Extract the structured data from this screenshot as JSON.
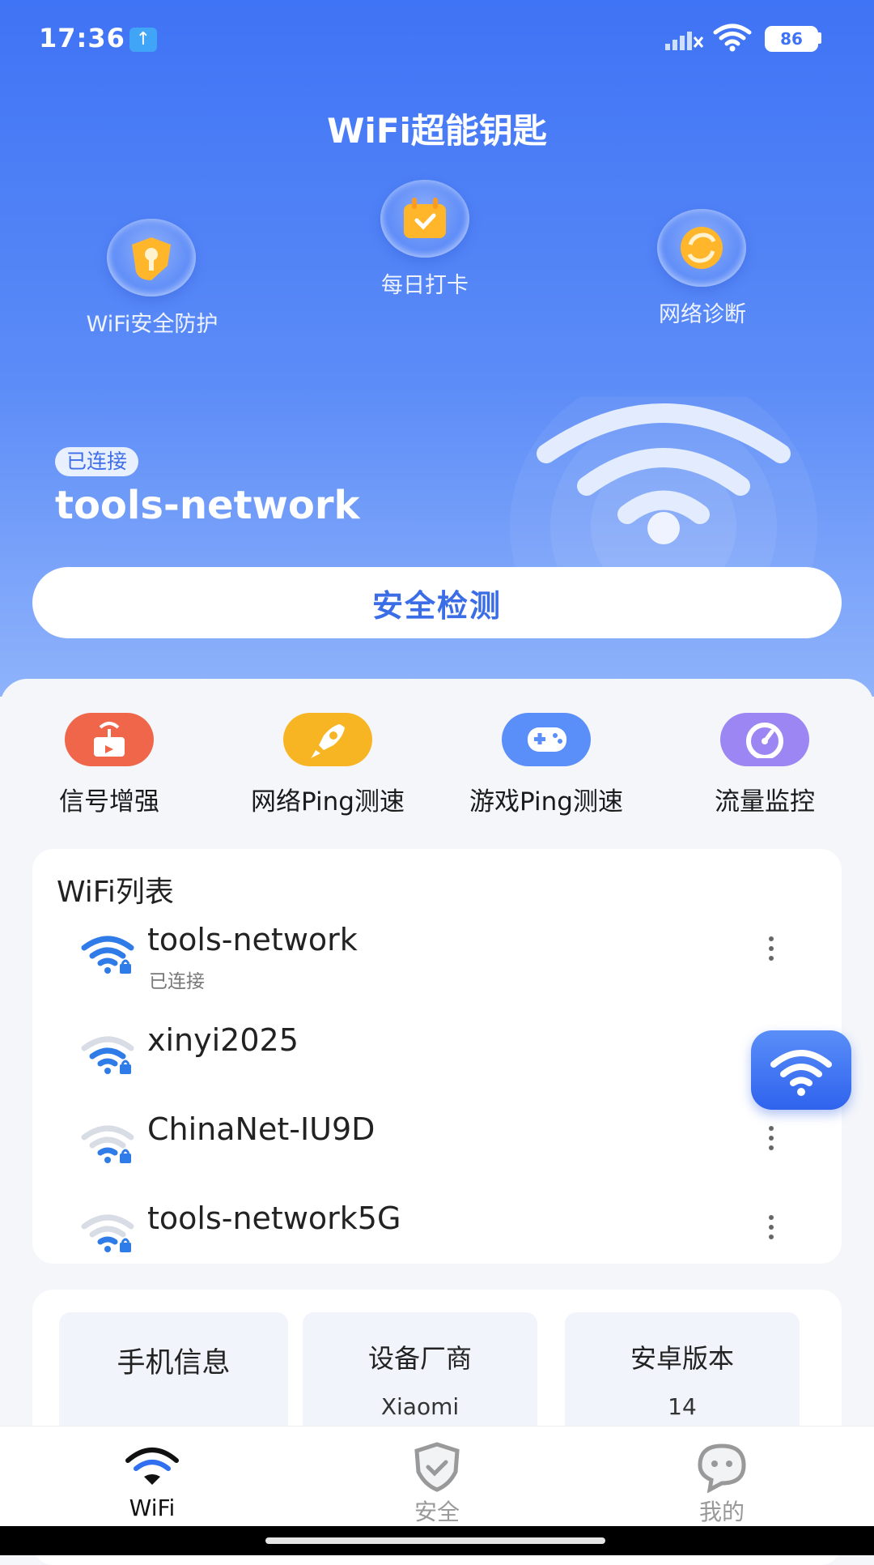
{
  "status_bar": {
    "time": "17:36",
    "upload_icon": "↑",
    "battery": "86"
  },
  "app_title": "WiFi超能钥匙",
  "features": [
    {
      "label": "WiFi安全防护",
      "icon": "shield-key-icon"
    },
    {
      "label": "每日打卡",
      "icon": "calendar-check-icon"
    },
    {
      "label": "网络诊断",
      "icon": "refresh-icon"
    }
  ],
  "connection": {
    "tag": "已连接",
    "ssid": "tools-network"
  },
  "scan_button": "安全检测",
  "tools": [
    {
      "label": "信号增强",
      "icon": "signal-tower-icon",
      "color": "#f0664a"
    },
    {
      "label": "网络Ping测速",
      "icon": "rocket-icon",
      "color": "#f7b524"
    },
    {
      "label": "游戏Ping测速",
      "icon": "gamepad-icon",
      "color": "#5a8ef8"
    },
    {
      "label": "流量监控",
      "icon": "gauge-icon",
      "color": "#9b86f3"
    }
  ],
  "wifi_list": {
    "title": "WiFi列表",
    "items": [
      {
        "ssid": "tools-network",
        "status": "已连接",
        "signal": 3
      },
      {
        "ssid": "xinyi2025",
        "status": "",
        "signal": 2
      },
      {
        "ssid": "ChinaNet-IU9D",
        "status": "",
        "signal": 1
      },
      {
        "ssid": "tools-network5G",
        "status": "",
        "signal": 1
      }
    ]
  },
  "phone_info": {
    "title": "手机信息",
    "vendor_label": "设备厂商",
    "vendor_value": "Xiaomi",
    "android_label": "安卓版本",
    "android_value": "14"
  },
  "bottom_nav": [
    {
      "label": "WiFi",
      "icon": "wifi-icon",
      "active": true
    },
    {
      "label": "安全",
      "icon": "shield-check-icon",
      "active": false
    },
    {
      "label": "我的",
      "icon": "chat-face-icon",
      "active": false
    }
  ],
  "colors": {
    "primary": "#3f73f5",
    "active_nav": "#111111",
    "inactive_nav": "#999999"
  }
}
